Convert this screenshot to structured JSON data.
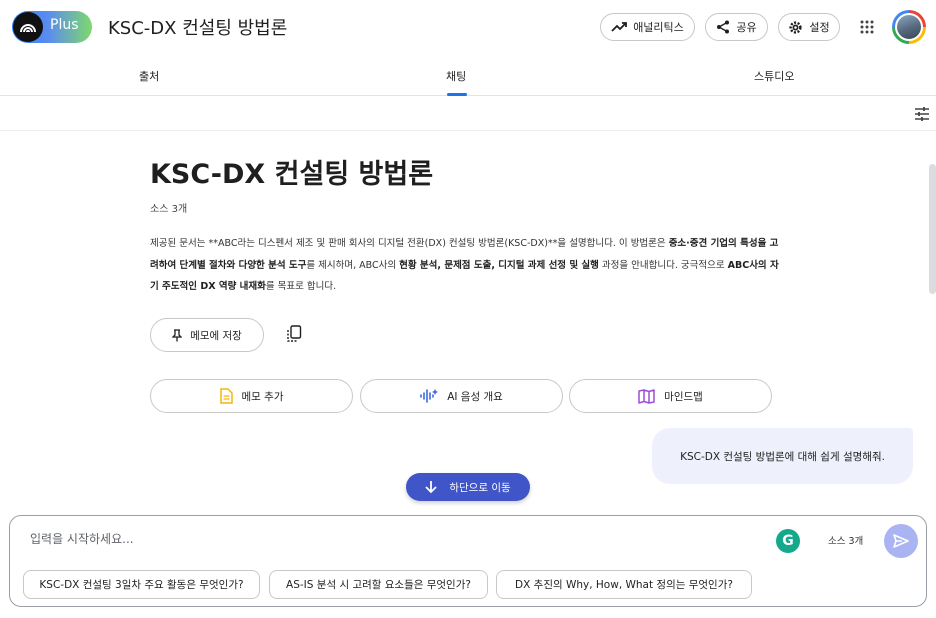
{
  "header": {
    "logo_text": "Plus",
    "title": "KSC-DX 컨설팅 방법론",
    "analytics_label": "애널리틱스",
    "share_label": "공유",
    "settings_label": "설정"
  },
  "tabs": [
    {
      "label": "출처"
    },
    {
      "label": "채팅"
    },
    {
      "label": "스튜디오"
    }
  ],
  "active_tab": "채팅",
  "notebook": {
    "title": "KSC-DX 컨설팅 방법론",
    "source_count": "소스 3개",
    "summary": {
      "p1": "제공된 문서는 **ABC라는 디스펜서 제조 및 판매 회사의 디지털 전환(DX) 컨설팅 방법론(KSC-DX)**을 설명합니다. 이 방법론은 ",
      "b1": "중소·중견 기업의 특성을 고려하여 단계별 절차와 다양한 분석 도구",
      "p2": "를 제시하며, ABC사의 ",
      "b2": "현황 분석, 문제점 도출, 디지털 과제 선정 및 실행",
      "p3": " 과정을 안내합니다. 궁극적으로 ",
      "b3": "ABC사의 자기 주도적인 DX 역량 내재화",
      "p4": "를 목표로 합니다."
    },
    "save_memo_label": "메모에 저장"
  },
  "actions": [
    {
      "label": "메모 추가"
    },
    {
      "label": "AI 음성 개요"
    },
    {
      "label": "마인드맵"
    }
  ],
  "chat": {
    "user_message": "KSC-DX 컨설팅 방법론에 대해 쉽게 설명해줘.",
    "scroll_bottom_label": "하단으로 이동"
  },
  "input": {
    "placeholder": "입력을 시작하세요...",
    "source_count": "소스 3개",
    "grammarly_letter": "G"
  },
  "suggestions": [
    {
      "label": "KSC-DX 컨설팅 3일차 주요 활동은 무엇인가?"
    },
    {
      "label": "AS-IS 분석 시 고려할 요소들은 무엇인가?"
    },
    {
      "label": "DX 추진의 Why, How, What 정의는 무엇인가?"
    }
  ],
  "colors": {
    "accent": "#1a73e8",
    "scroll_button": "#3f55c8",
    "user_bubble": "#eef0fb",
    "send_button": "#aab4f2",
    "memo_icon": "#f2b705",
    "audio_icon": "#3f6ae0",
    "mindmap_icon": "#9b4fd8"
  },
  "icons": [
    "logo-icon",
    "trending-up-icon",
    "share-icon",
    "gear-icon",
    "apps-grid-icon",
    "tune-icon",
    "pin-icon",
    "copy-icon",
    "note-icon",
    "audio-waveform-icon",
    "mindmap-icon",
    "arrow-down-icon",
    "grammarly-icon",
    "send-icon"
  ]
}
